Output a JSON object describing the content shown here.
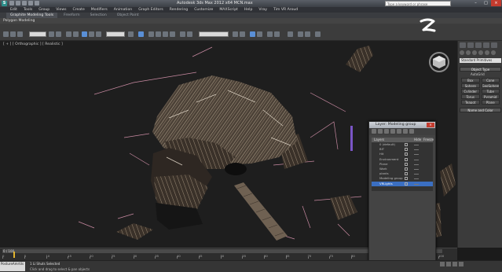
{
  "window": {
    "title": "Autodesk 3ds Max 2012 x64     MCN.max",
    "search_placeholder": "Type a keyword or phrase",
    "controls": [
      "–",
      "□",
      "×"
    ]
  },
  "menu": [
    "Edit",
    "Tools",
    "Group",
    "Views",
    "Create",
    "Modifiers",
    "Animation",
    "Graph Editors",
    "Rendering",
    "Customize",
    "MAXScript",
    "Help",
    "Vray",
    "Tim VR Aroud"
  ],
  "ribbon": {
    "tabs": [
      "Graphite Modeling Tools",
      "Freeform",
      "Selection",
      "Object Paint"
    ],
    "active_tab": 0,
    "panel_label": "Polygon Modeling"
  },
  "toolbar": {
    "selection_filter": "All",
    "reference_coord": "View",
    "named_selection": "Create Selection Se"
  },
  "viewport": {
    "label": "[ + ] [ Orthographic ] [ Realistic ]"
  },
  "command_panel": {
    "category_dropdown": "Standard Primitives",
    "object_type_title": "Object Type",
    "autogrid": "AutoGrid",
    "objects": [
      "Box",
      "Cone",
      "Sphere",
      "GeoSphere",
      "Cylinder",
      "Tube",
      "Torus",
      "Pyramid",
      "Teapot",
      "Plane"
    ],
    "name_color_title": "Name and Color"
  },
  "layer_dialog": {
    "title": "Layer: Modeling group",
    "columns": [
      "Layers",
      "Hide",
      "Freeze"
    ],
    "layers": [
      "0 (default)",
      "BIT",
      "Hit",
      "Environment",
      "Plane",
      "Work",
      "plants",
      "Modeling group",
      "VRLights"
    ],
    "selected_index": 8
  },
  "timeline": {
    "slider_label": "0 / 100",
    "ticks": [
      0,
      5,
      10,
      15,
      20,
      25,
      30,
      35,
      40,
      45,
      50,
      55,
      60,
      65,
      70,
      75,
      80,
      85,
      90,
      95,
      100
    ]
  },
  "status": {
    "maxscript_label": "PostureAmrtils",
    "line1": "1 Li Shuts Selected",
    "line2": "Click and drag to select & pan objects"
  },
  "colors": {
    "viewport_bg": "#1e1e1e",
    "panel_bg": "#3b3b3b",
    "selection_blue": "#3b6fc2",
    "gizmo_pink": "#c98aa2",
    "wood": "#6f6152"
  }
}
